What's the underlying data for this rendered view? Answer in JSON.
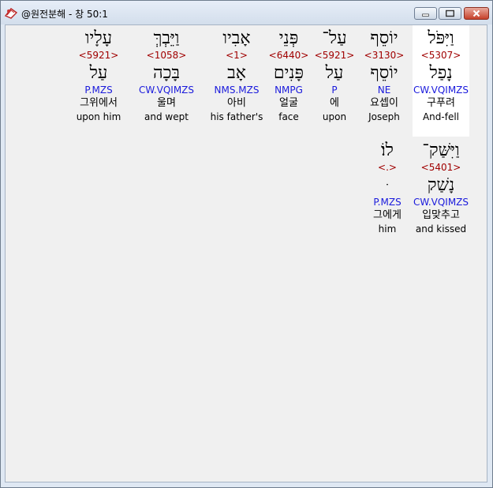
{
  "window": {
    "title": "@원전분해 - 창 50:1",
    "icon": "bible-book-icon",
    "controls": [
      "minimize-icon",
      "maximize-icon",
      "close-icon"
    ]
  },
  "words": [
    {
      "hebrew": "וַיִּפֹּל",
      "strong": "<5307>",
      "lemma": "נָפַל",
      "parse": "CW.VQIMZS",
      "korean": "구푸려",
      "english": "And-fell"
    },
    {
      "hebrew": "יוֹסֵף",
      "strong": "<3130>",
      "lemma": "יוֹסֵף",
      "parse": "NE",
      "korean": "요셉이",
      "english": "Joseph"
    },
    {
      "hebrew": "עַל־",
      "strong": "<5921>",
      "lemma": "עַל",
      "parse": "P",
      "korean": "에",
      "english": "upon"
    },
    {
      "hebrew": "פְּנֵי",
      "strong": "<6440>",
      "lemma": "פָּנִים",
      "parse": "NMPG",
      "korean": "얼굴",
      "english": "face"
    },
    {
      "hebrew": "אָבִיו",
      "strong": "<1>",
      "lemma": "אָב",
      "parse": "NMS.MZS",
      "korean": "아비",
      "english": "his father's"
    },
    {
      "hebrew": "וַיֵּבְךְּ",
      "strong": "<1058>",
      "lemma": "בָּכָה",
      "parse": "CW.VQIMZS",
      "korean": "울며",
      "english": "and wept"
    },
    {
      "hebrew": "עָלָיו",
      "strong": "<5921>",
      "lemma": "עַל",
      "parse": "P.MZS",
      "korean": "그위에서",
      "english": "upon him"
    },
    {
      "hebrew": "וַיִּשַּׁק־",
      "strong": "<5401>",
      "lemma": "נָשַׁק",
      "parse": "CW.VQIMZS",
      "korean": "입맞추고",
      "english": "and kissed"
    },
    {
      "hebrew": "לוֹ׃",
      "strong": "<.>",
      "lemma": "ּ",
      "parse": "P.MZS",
      "korean": "그에게",
      "english": "him"
    }
  ]
}
